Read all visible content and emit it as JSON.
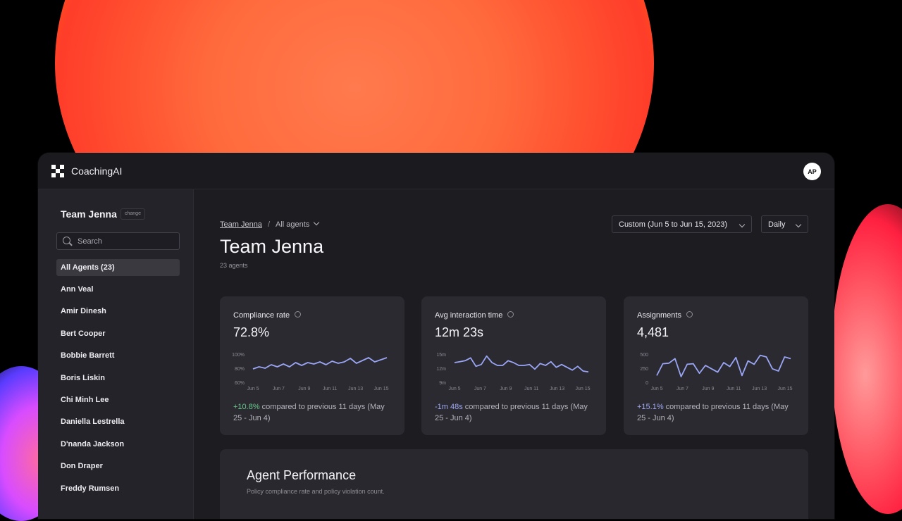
{
  "app": {
    "brand": "CoachingAI",
    "avatar_initials": "AP"
  },
  "sidebar": {
    "team": "Team Jenna",
    "change_label": "change",
    "search_placeholder": "Search",
    "items": [
      {
        "label": "All Agents  (23)",
        "active": true
      },
      {
        "label": "Ann Veal"
      },
      {
        "label": "Amir Dinesh"
      },
      {
        "label": "Bert Cooper"
      },
      {
        "label": "Bobbie Barrett"
      },
      {
        "label": "Boris Liskin"
      },
      {
        "label": "Chi Minh Lee"
      },
      {
        "label": "Daniella Lestrella"
      },
      {
        "label": "D'nanda Jackson"
      },
      {
        "label": "Don Draper"
      },
      {
        "label": "Freddy Rumsen"
      }
    ]
  },
  "header": {
    "breadcrumb_team": "Team Jenna",
    "breadcrumb_sep": "/",
    "breadcrumb_current": "All agents",
    "title": "Team Jenna",
    "subtitle": "23 agents",
    "date_range": "Custom (Jun 5 to Jun 15, 2023)",
    "granularity": "Daily"
  },
  "cards": [
    {
      "title": "Compliance rate",
      "value": "72.8%",
      "delta": "+10.8%",
      "delta_kind": "pos",
      "compare": " compared to previous 11 days (May 25 - Jun 4)",
      "chart_data": {
        "type": "line",
        "x": [
          "Jun 5",
          "Jun 7",
          "Jun 9",
          "Jun 11",
          "Jun 13",
          "Jun 15"
        ],
        "y_ticks": [
          "100%",
          "80%",
          "60%"
        ],
        "ylim": [
          60,
          100
        ],
        "color": "#9aa6f5",
        "values": [
          79,
          82,
          80,
          85,
          82,
          86,
          82,
          88,
          84,
          88,
          86,
          89,
          85,
          90,
          87,
          89,
          94,
          87,
          91,
          95,
          89,
          92,
          95
        ]
      }
    },
    {
      "title": "Avg interaction time",
      "value": "12m 23s",
      "delta": "-1m 48s",
      "delta_kind": "neg",
      "compare": " compared to previous 11 days (May 25 - Jun 4)",
      "chart_data": {
        "type": "line",
        "x": [
          "Jun 5",
          "Jun 7",
          "Jun 9",
          "Jun 11",
          "Jun 13",
          "Jun 15"
        ],
        "y_ticks": [
          "15m",
          "12m",
          "9m"
        ],
        "ylim": [
          9,
          15
        ],
        "color": "#9aa6f5",
        "values": [
          13.2,
          13.4,
          13.6,
          14.2,
          12.4,
          12.8,
          14.6,
          13.2,
          12.6,
          12.6,
          13.6,
          13.2,
          12.6,
          12.6,
          12.8,
          11.8,
          13.0,
          12.6,
          13.4,
          12.2,
          12.8,
          12.2,
          11.6,
          12.4,
          11.4,
          11.2
        ]
      }
    },
    {
      "title": "Assignments",
      "value": "4,481",
      "delta": "+15.1%",
      "delta_kind": "neg",
      "compare": " compared to previous 11 days (May 25 - Jun 4)",
      "chart_data": {
        "type": "line",
        "x": [
          "Jun 5",
          "Jun 7",
          "Jun 9",
          "Jun 11",
          "Jun 13",
          "Jun 15"
        ],
        "y_ticks": [
          "500",
          "250",
          "0"
        ],
        "ylim": [
          0,
          500
        ],
        "color": "#9aa6f5",
        "values": [
          120,
          330,
          340,
          420,
          100,
          320,
          330,
          160,
          300,
          240,
          180,
          350,
          280,
          440,
          120,
          380,
          320,
          480,
          450,
          240,
          200,
          450,
          420
        ]
      }
    }
  ],
  "performance": {
    "title": "Agent Performance",
    "subtitle": "Policy compliance rate and policy violation count."
  }
}
